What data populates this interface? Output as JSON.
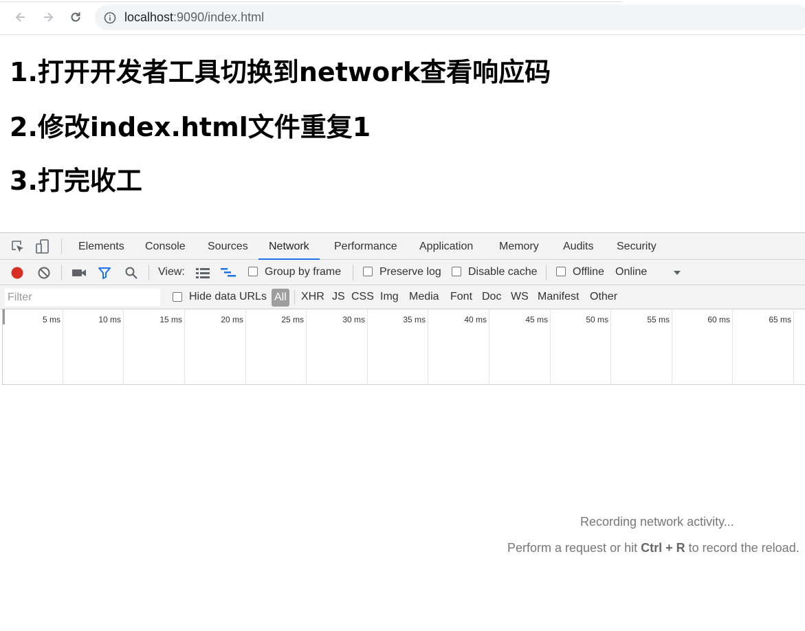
{
  "browser": {
    "url_host": "localhost",
    "url_rest": ":9090/index.html"
  },
  "page": {
    "lines": [
      "1.打开开发者工具切换到network查看响应码",
      "2.修改index.html文件重复1",
      "3.打完收工"
    ]
  },
  "devtools": {
    "tabs": [
      {
        "label": "Elements",
        "active": false
      },
      {
        "label": "Console",
        "active": false
      },
      {
        "label": "Sources",
        "active": false
      },
      {
        "label": "Network",
        "active": true
      },
      {
        "label": "Performance",
        "active": false
      },
      {
        "label": "Application",
        "active": false
      },
      {
        "label": "Memory",
        "active": false
      },
      {
        "label": "Audits",
        "active": false
      },
      {
        "label": "Security",
        "active": false
      }
    ],
    "toolbar": {
      "view_label": "View:",
      "group_by_frame": "Group by frame",
      "preserve_log": "Preserve log",
      "disable_cache": "Disable cache",
      "offline": "Offline",
      "throttling": "Online"
    },
    "filter": {
      "placeholder": "Filter",
      "hide_data_urls": "Hide data URLs",
      "types": [
        "All",
        "XHR",
        "JS",
        "CSS",
        "Img",
        "Media",
        "Font",
        "Doc",
        "WS",
        "Manifest",
        "Other"
      ]
    },
    "timeline": {
      "ticks": [
        "5 ms",
        "10 ms",
        "15 ms",
        "20 ms",
        "25 ms",
        "30 ms",
        "35 ms",
        "40 ms",
        "45 ms",
        "50 ms",
        "55 ms",
        "60 ms",
        "65 ms"
      ]
    },
    "empty_state": {
      "recording": "Recording network activity...",
      "hint_prefix": "Perform a request or hit ",
      "hint_key1": "Ctrl",
      "hint_plus": " + ",
      "hint_key2": "R",
      "hint_suffix": " to record the reload."
    },
    "colors": {
      "record": "#d93025",
      "accent": "#1a73e8"
    }
  }
}
